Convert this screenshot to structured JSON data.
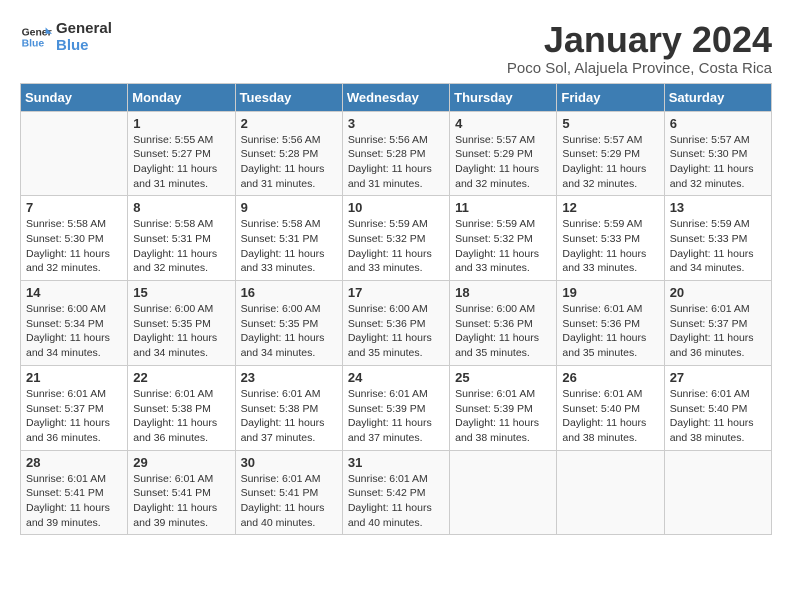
{
  "logo": {
    "line1": "General",
    "line2": "Blue"
  },
  "title": "January 2024",
  "subtitle": "Poco Sol, Alajuela Province, Costa Rica",
  "weekdays": [
    "Sunday",
    "Monday",
    "Tuesday",
    "Wednesday",
    "Thursday",
    "Friday",
    "Saturday"
  ],
  "weeks": [
    [
      {
        "day": "",
        "info": ""
      },
      {
        "day": "1",
        "info": "Sunrise: 5:55 AM\nSunset: 5:27 PM\nDaylight: 11 hours\nand 31 minutes."
      },
      {
        "day": "2",
        "info": "Sunrise: 5:56 AM\nSunset: 5:28 PM\nDaylight: 11 hours\nand 31 minutes."
      },
      {
        "day": "3",
        "info": "Sunrise: 5:56 AM\nSunset: 5:28 PM\nDaylight: 11 hours\nand 31 minutes."
      },
      {
        "day": "4",
        "info": "Sunrise: 5:57 AM\nSunset: 5:29 PM\nDaylight: 11 hours\nand 32 minutes."
      },
      {
        "day": "5",
        "info": "Sunrise: 5:57 AM\nSunset: 5:29 PM\nDaylight: 11 hours\nand 32 minutes."
      },
      {
        "day": "6",
        "info": "Sunrise: 5:57 AM\nSunset: 5:30 PM\nDaylight: 11 hours\nand 32 minutes."
      }
    ],
    [
      {
        "day": "7",
        "info": "Sunrise: 5:58 AM\nSunset: 5:30 PM\nDaylight: 11 hours\nand 32 minutes."
      },
      {
        "day": "8",
        "info": "Sunrise: 5:58 AM\nSunset: 5:31 PM\nDaylight: 11 hours\nand 32 minutes."
      },
      {
        "day": "9",
        "info": "Sunrise: 5:58 AM\nSunset: 5:31 PM\nDaylight: 11 hours\nand 33 minutes."
      },
      {
        "day": "10",
        "info": "Sunrise: 5:59 AM\nSunset: 5:32 PM\nDaylight: 11 hours\nand 33 minutes."
      },
      {
        "day": "11",
        "info": "Sunrise: 5:59 AM\nSunset: 5:32 PM\nDaylight: 11 hours\nand 33 minutes."
      },
      {
        "day": "12",
        "info": "Sunrise: 5:59 AM\nSunset: 5:33 PM\nDaylight: 11 hours\nand 33 minutes."
      },
      {
        "day": "13",
        "info": "Sunrise: 5:59 AM\nSunset: 5:33 PM\nDaylight: 11 hours\nand 34 minutes."
      }
    ],
    [
      {
        "day": "14",
        "info": "Sunrise: 6:00 AM\nSunset: 5:34 PM\nDaylight: 11 hours\nand 34 minutes."
      },
      {
        "day": "15",
        "info": "Sunrise: 6:00 AM\nSunset: 5:35 PM\nDaylight: 11 hours\nand 34 minutes."
      },
      {
        "day": "16",
        "info": "Sunrise: 6:00 AM\nSunset: 5:35 PM\nDaylight: 11 hours\nand 34 minutes."
      },
      {
        "day": "17",
        "info": "Sunrise: 6:00 AM\nSunset: 5:36 PM\nDaylight: 11 hours\nand 35 minutes."
      },
      {
        "day": "18",
        "info": "Sunrise: 6:00 AM\nSunset: 5:36 PM\nDaylight: 11 hours\nand 35 minutes."
      },
      {
        "day": "19",
        "info": "Sunrise: 6:01 AM\nSunset: 5:36 PM\nDaylight: 11 hours\nand 35 minutes."
      },
      {
        "day": "20",
        "info": "Sunrise: 6:01 AM\nSunset: 5:37 PM\nDaylight: 11 hours\nand 36 minutes."
      }
    ],
    [
      {
        "day": "21",
        "info": "Sunrise: 6:01 AM\nSunset: 5:37 PM\nDaylight: 11 hours\nand 36 minutes."
      },
      {
        "day": "22",
        "info": "Sunrise: 6:01 AM\nSunset: 5:38 PM\nDaylight: 11 hours\nand 36 minutes."
      },
      {
        "day": "23",
        "info": "Sunrise: 6:01 AM\nSunset: 5:38 PM\nDaylight: 11 hours\nand 37 minutes."
      },
      {
        "day": "24",
        "info": "Sunrise: 6:01 AM\nSunset: 5:39 PM\nDaylight: 11 hours\nand 37 minutes."
      },
      {
        "day": "25",
        "info": "Sunrise: 6:01 AM\nSunset: 5:39 PM\nDaylight: 11 hours\nand 38 minutes."
      },
      {
        "day": "26",
        "info": "Sunrise: 6:01 AM\nSunset: 5:40 PM\nDaylight: 11 hours\nand 38 minutes."
      },
      {
        "day": "27",
        "info": "Sunrise: 6:01 AM\nSunset: 5:40 PM\nDaylight: 11 hours\nand 38 minutes."
      }
    ],
    [
      {
        "day": "28",
        "info": "Sunrise: 6:01 AM\nSunset: 5:41 PM\nDaylight: 11 hours\nand 39 minutes."
      },
      {
        "day": "29",
        "info": "Sunrise: 6:01 AM\nSunset: 5:41 PM\nDaylight: 11 hours\nand 39 minutes."
      },
      {
        "day": "30",
        "info": "Sunrise: 6:01 AM\nSunset: 5:41 PM\nDaylight: 11 hours\nand 40 minutes."
      },
      {
        "day": "31",
        "info": "Sunrise: 6:01 AM\nSunset: 5:42 PM\nDaylight: 11 hours\nand 40 minutes."
      },
      {
        "day": "",
        "info": ""
      },
      {
        "day": "",
        "info": ""
      },
      {
        "day": "",
        "info": ""
      }
    ]
  ]
}
